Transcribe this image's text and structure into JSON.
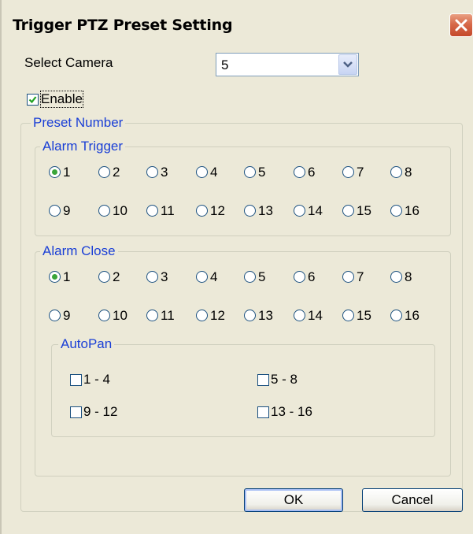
{
  "window": {
    "title": "Trigger PTZ Preset Setting"
  },
  "camera": {
    "label": "Select Camera",
    "selected": "5"
  },
  "enable": {
    "label": "Enable",
    "checked": true
  },
  "preset_group": {
    "label": "Preset Number"
  },
  "alarm_trigger": {
    "label": "Alarm Trigger",
    "selected": "1",
    "options": [
      "1",
      "2",
      "3",
      "4",
      "5",
      "6",
      "7",
      "8",
      "9",
      "10",
      "11",
      "12",
      "13",
      "14",
      "15",
      "16"
    ]
  },
  "alarm_close": {
    "label": "Alarm Close",
    "selected": "1",
    "options": [
      "1",
      "2",
      "3",
      "4",
      "5",
      "6",
      "7",
      "8",
      "9",
      "10",
      "11",
      "12",
      "13",
      "14",
      "15",
      "16"
    ]
  },
  "autopan": {
    "label": "AutoPan",
    "items": [
      {
        "label": "1 - 4",
        "checked": false
      },
      {
        "label": "5 - 8",
        "checked": false
      },
      {
        "label": "9 - 12",
        "checked": false
      },
      {
        "label": "13 - 16",
        "checked": false
      }
    ]
  },
  "buttons": {
    "ok": "OK",
    "cancel": "Cancel"
  },
  "colors": {
    "group_label": "#1a3fd6",
    "radio_selected": "#3aa53a",
    "close_button": "#d7694a"
  }
}
